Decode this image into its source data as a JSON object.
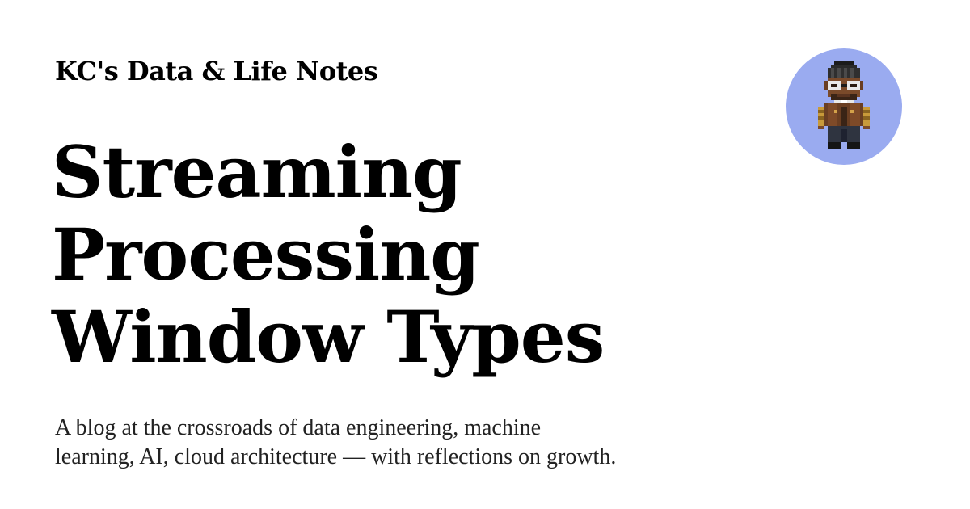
{
  "header": {
    "site_title": "KC's Data & Life Notes"
  },
  "post": {
    "title_lines": [
      "Streaming",
      "Processing",
      "Window Types"
    ]
  },
  "tagline": {
    "lines": [
      "A blog at the crossroads of data engineering, machine",
      "learning, AI, cloud architecture — with reflections on growth."
    ]
  },
  "avatar": {
    "icon": "pixel-art-character-avatar",
    "background_color": "#9aabf0"
  },
  "colors": {
    "background": "#ffffff",
    "text": "#000000"
  }
}
